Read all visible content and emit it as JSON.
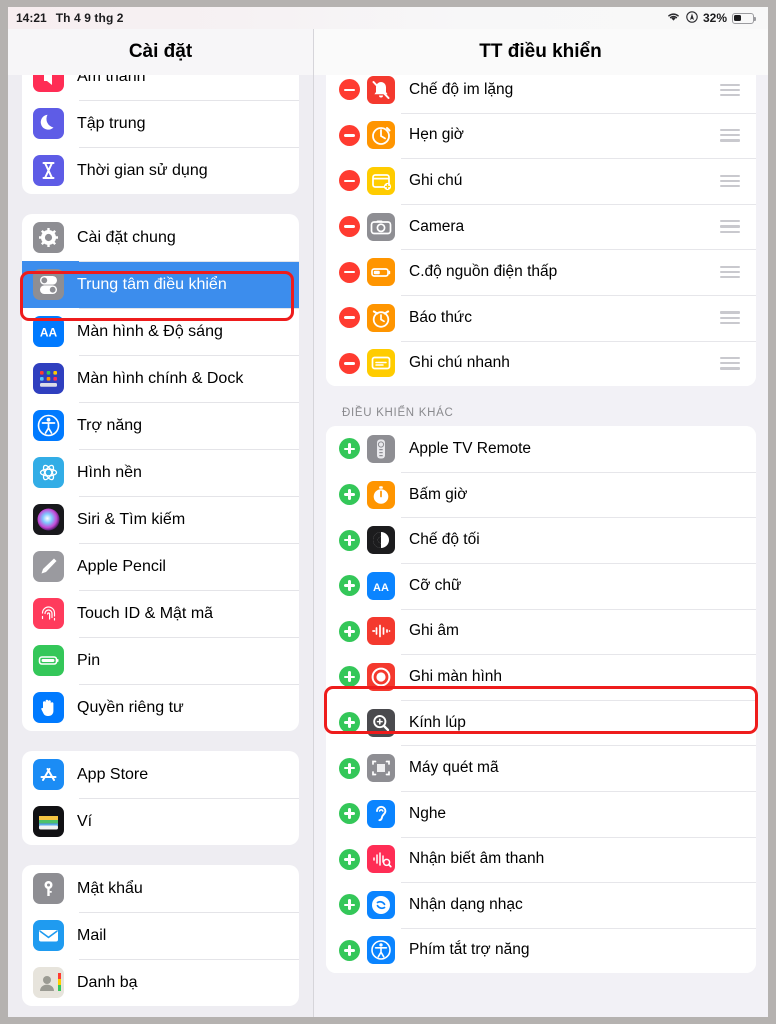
{
  "status_bar": {
    "time": "14:21",
    "date": "Th 4 9 thg 2",
    "wifi_icon": "wifi-icon",
    "location_icon": "location-icon",
    "battery_percent": "32%",
    "battery_level": 32
  },
  "nav": {
    "sidebar_title": "Cài đặt",
    "detail_title": "TT điều khiển"
  },
  "sidebar": {
    "groups": [
      {
        "clipped": true,
        "items": [
          {
            "label": "Âm thanh",
            "icon": "sound-icon",
            "selected": false,
            "partial": true
          },
          {
            "label": "Tập trung",
            "icon": "focus-moon-icon",
            "selected": false
          },
          {
            "label": "Thời gian sử dụng",
            "icon": "screen-time-icon",
            "selected": false
          }
        ]
      },
      {
        "clipped": false,
        "items": [
          {
            "label": "Cài đặt chung",
            "icon": "gear-icon",
            "selected": false
          },
          {
            "label": "Trung tâm điều khiển",
            "icon": "control-center-icon",
            "selected": true
          },
          {
            "label": "Màn hình & Độ sáng",
            "icon": "display-brightness-icon",
            "selected": false
          },
          {
            "label": "Màn hình chính & Dock",
            "icon": "home-screen-dock-icon",
            "selected": false
          },
          {
            "label": "Trợ năng",
            "icon": "accessibility-icon",
            "selected": false
          },
          {
            "label": "Hình nền",
            "icon": "wallpaper-icon",
            "selected": false
          },
          {
            "label": "Siri & Tìm kiếm",
            "icon": "siri-icon",
            "selected": false
          },
          {
            "label": "Apple Pencil",
            "icon": "apple-pencil-icon",
            "selected": false
          },
          {
            "label": "Touch ID & Mật mã",
            "icon": "touch-id-icon",
            "selected": false
          },
          {
            "label": "Pin",
            "icon": "battery-icon",
            "selected": false
          },
          {
            "label": "Quyền riêng tư",
            "icon": "privacy-hand-icon",
            "selected": false
          }
        ]
      },
      {
        "clipped": false,
        "items": [
          {
            "label": "App Store",
            "icon": "app-store-icon",
            "selected": false
          },
          {
            "label": "Ví",
            "icon": "wallet-icon",
            "selected": false
          }
        ]
      },
      {
        "clipped": false,
        "items": [
          {
            "label": "Mật khẩu",
            "icon": "passwords-key-icon",
            "selected": false
          },
          {
            "label": "Mail",
            "icon": "mail-icon",
            "selected": false
          },
          {
            "label": "Danh bạ",
            "icon": "contacts-icon",
            "selected": false
          }
        ]
      }
    ]
  },
  "detail": {
    "included_section": {
      "clipped": true,
      "rows": [
        {
          "label": "Chế độ im lặng",
          "icon": "silent-mode-icon",
          "action": "remove",
          "handle": "drag-handle"
        },
        {
          "label": "Hẹn giờ",
          "icon": "timer-icon",
          "action": "remove",
          "handle": "drag-handle"
        },
        {
          "label": "Ghi chú",
          "icon": "notes-icon",
          "action": "remove",
          "handle": "drag-handle"
        },
        {
          "label": "Camera",
          "icon": "camera-icon",
          "action": "remove",
          "handle": "drag-handle"
        },
        {
          "label": "C.độ nguồn điện thấp",
          "icon": "low-power-mode-icon",
          "action": "remove",
          "handle": "drag-handle"
        },
        {
          "label": "Báo thức",
          "icon": "alarm-clock-icon",
          "action": "remove",
          "handle": "drag-handle"
        },
        {
          "label": "Ghi chú nhanh",
          "icon": "quick-note-icon",
          "action": "remove",
          "handle": "drag-handle"
        }
      ]
    },
    "more_controls_header": "ĐIỀU KHIỂN KHÁC",
    "more_section": {
      "rows": [
        {
          "label": "Apple TV Remote",
          "icon": "apple-tv-remote-icon",
          "action": "add",
          "highlighted": false
        },
        {
          "label": "Bấm giờ",
          "icon": "stopwatch-icon",
          "action": "add",
          "highlighted": false
        },
        {
          "label": "Chế độ tối",
          "icon": "dark-mode-icon",
          "action": "add",
          "highlighted": false
        },
        {
          "label": "Cỡ chữ",
          "icon": "text-size-icon",
          "action": "add",
          "highlighted": false
        },
        {
          "label": "Ghi âm",
          "icon": "voice-memos-icon",
          "action": "add",
          "highlighted": false
        },
        {
          "label": "Ghi màn hình",
          "icon": "screen-recording-icon",
          "action": "add",
          "highlighted": true
        },
        {
          "label": "Kính lúp",
          "icon": "magnifier-icon",
          "action": "add",
          "highlighted": false
        },
        {
          "label": "Máy quét mã",
          "icon": "code-scanner-icon",
          "action": "add",
          "highlighted": false
        },
        {
          "label": "Nghe",
          "icon": "hearing-icon",
          "action": "add",
          "highlighted": false
        },
        {
          "label": "Nhận biết âm thanh",
          "icon": "sound-recognition-icon",
          "action": "add",
          "highlighted": false
        },
        {
          "label": "Nhận dạng nhạc",
          "icon": "music-recognition-icon",
          "action": "add",
          "highlighted": false
        },
        {
          "label": "Phím tắt trợ năng",
          "icon": "accessibility-shortcut-icon",
          "action": "add",
          "highlighted": false
        }
      ]
    }
  },
  "annotations": {
    "sidebar_highlight_target": "Trung tâm điều khiển",
    "detail_highlight_target": "Ghi màn hình",
    "color": "#ee1c1c"
  }
}
